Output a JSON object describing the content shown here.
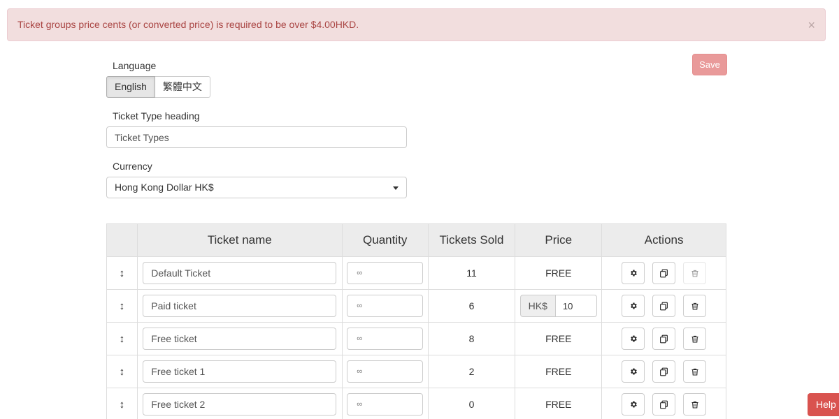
{
  "alert": {
    "message": "Ticket groups price cents (or converted price) is required to be over $4.00HKD.",
    "close": "×"
  },
  "form": {
    "language_label": "Language",
    "languages": [
      "English",
      "繁體中文"
    ],
    "save_label": "Save",
    "heading_label": "Ticket Type heading",
    "heading_value": "Ticket Types",
    "currency_label": "Currency",
    "currency_value": "Hong Kong Dollar HK$"
  },
  "table": {
    "headers": [
      "",
      "Ticket name",
      "Quantity",
      "Tickets Sold",
      "Price",
      "Actions"
    ],
    "drag_glyph": "↕",
    "rows": [
      {
        "name": "Default Ticket",
        "quantity": "∞",
        "sold": "11",
        "price": "FREE",
        "paid": false
      },
      {
        "name": "Paid ticket",
        "quantity": "∞",
        "sold": "6",
        "price_currency": "HK$",
        "price_value": "10",
        "paid": true
      },
      {
        "name": "Free ticket",
        "quantity": "∞",
        "sold": "8",
        "price": "FREE",
        "paid": false
      },
      {
        "name": "Free ticket 1",
        "quantity": "∞",
        "sold": "2",
        "price": "FREE",
        "paid": false
      },
      {
        "name": "Free ticket 2",
        "quantity": "∞",
        "sold": "0",
        "price": "FREE",
        "paid": false
      }
    ]
  },
  "help_label": "Help",
  "icons": {
    "settings": "gear-icon",
    "duplicate": "copy-icon",
    "delete": "trash-icon",
    "drag": "drag-handle-icon"
  }
}
